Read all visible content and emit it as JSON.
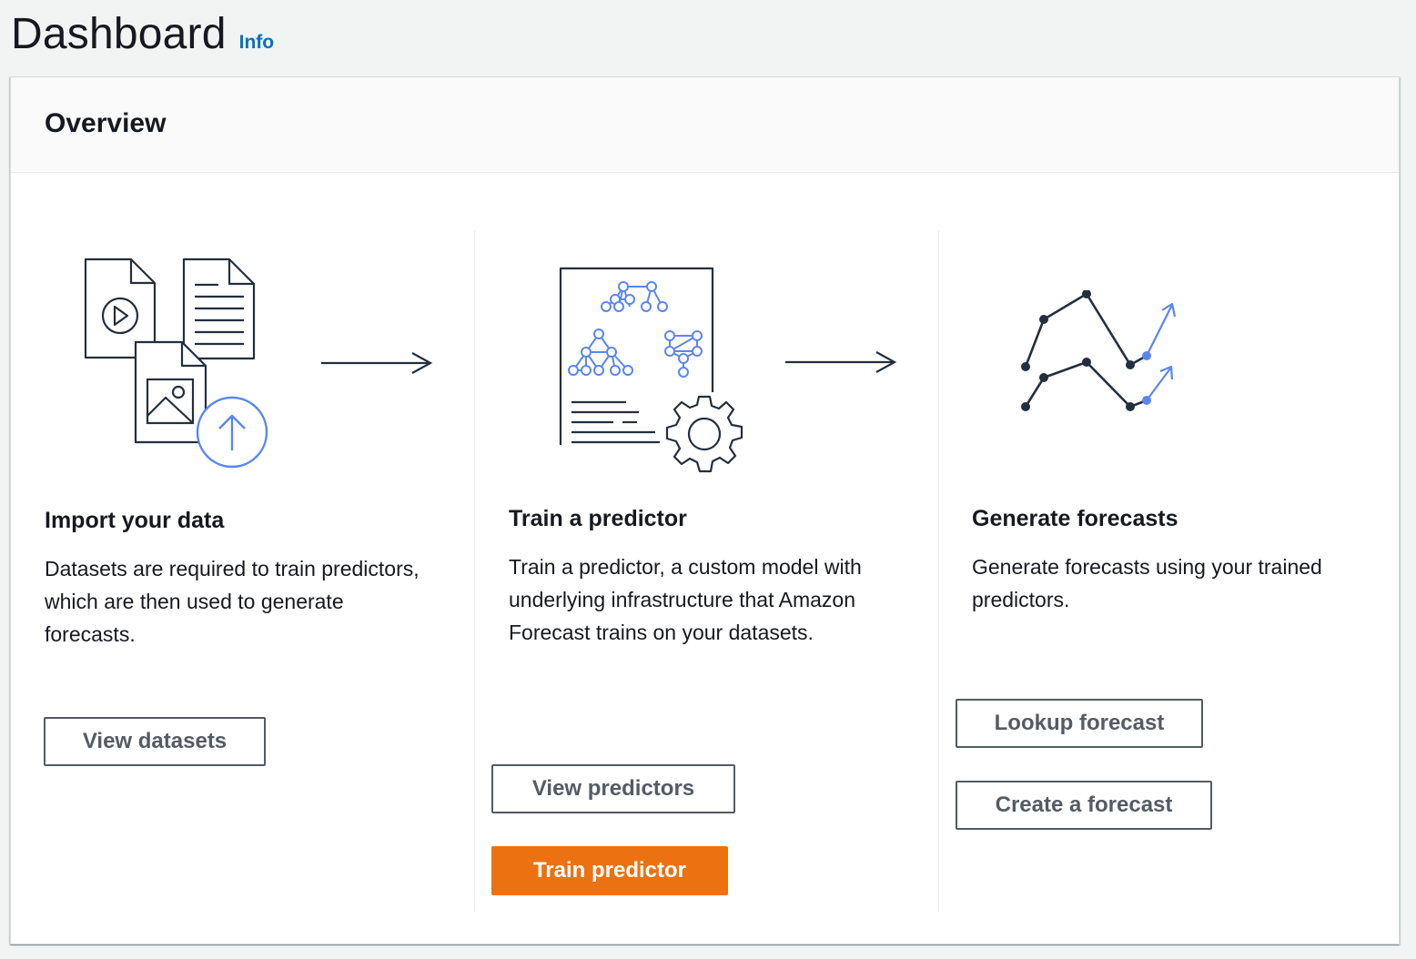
{
  "page": {
    "title": "Dashboard",
    "info_label": "Info"
  },
  "overview": {
    "title": "Overview",
    "steps": [
      {
        "title": "Import your data",
        "description": "Datasets are required to train predictors, which are then used to generate forecasts.",
        "buttons": [
          {
            "label": "View datasets"
          }
        ]
      },
      {
        "title": "Train a predictor",
        "description": "Train a predictor, a custom model with underlying infrastructure that Amazon Forecast trains on your datasets.",
        "buttons": [
          {
            "label": "View predictors"
          },
          {
            "label": "Train predictor"
          }
        ]
      },
      {
        "title": "Generate forecasts",
        "description": "Generate forecasts using your trained predictors.",
        "buttons": [
          {
            "label": "Lookup forecast"
          },
          {
            "label": "Create a forecast"
          }
        ]
      }
    ]
  },
  "icons": {
    "step1": "import-data-illustration-icon",
    "step2": "train-predictor-illustration-icon",
    "step3": "generate-forecasts-illustration-icon",
    "flow_arrow": "arrow-right-icon"
  },
  "colors": {
    "primary_button": "#ec7211",
    "link": "#0073bb",
    "illustration_accent": "#5a86f0",
    "illustration_dark": "#232f3e"
  }
}
